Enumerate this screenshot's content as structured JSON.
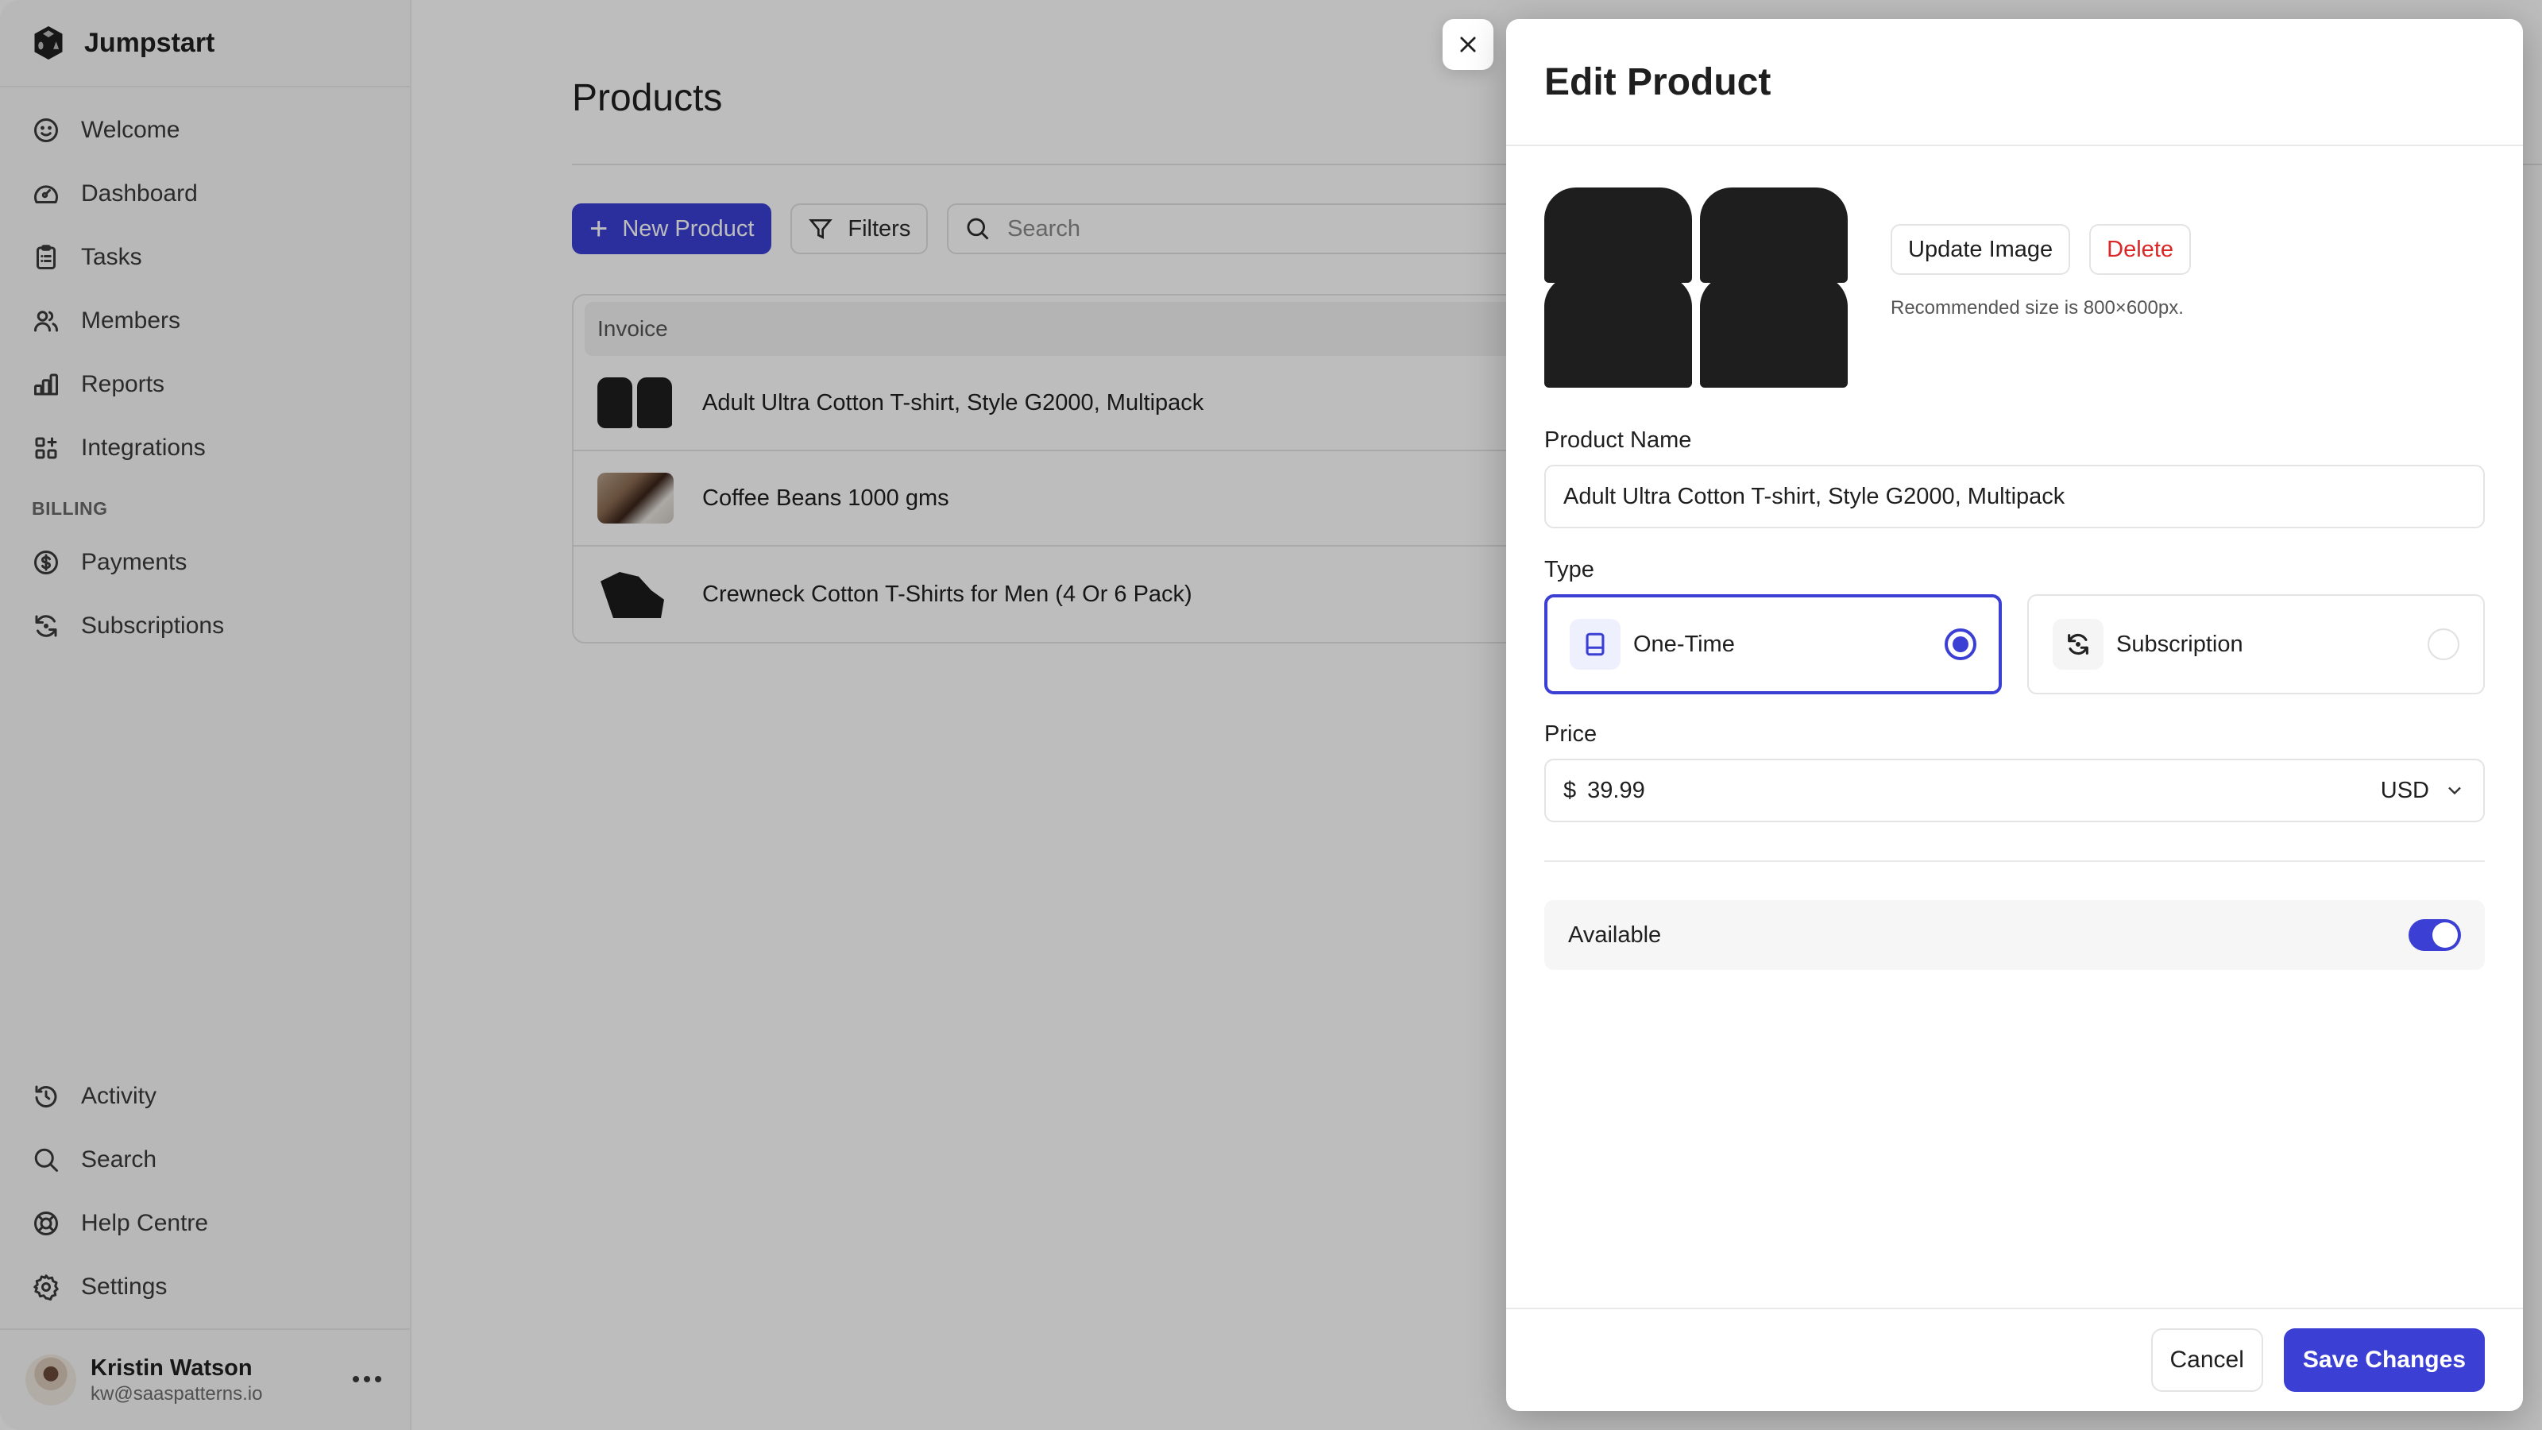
{
  "app": {
    "name": "Jumpstart",
    "accent_color": "#3b3fd4",
    "danger_color": "#d92626"
  },
  "sidebar": {
    "items": [
      {
        "label": "Welcome",
        "icon": "smile-icon"
      },
      {
        "label": "Dashboard",
        "icon": "gauge-icon"
      },
      {
        "label": "Tasks",
        "icon": "clipboard-icon"
      },
      {
        "label": "Members",
        "icon": "users-icon"
      },
      {
        "label": "Reports",
        "icon": "bar-chart-icon"
      },
      {
        "label": "Integrations",
        "icon": "grid-plus-icon"
      }
    ],
    "billing_section": "BILLING",
    "billing_items": [
      {
        "label": "Payments",
        "icon": "dollar-circle-icon"
      },
      {
        "label": "Subscriptions",
        "icon": "refresh-icon"
      }
    ],
    "bottom_items": [
      {
        "label": "Activity",
        "icon": "history-icon"
      },
      {
        "label": "Search",
        "icon": "search-icon"
      },
      {
        "label": "Help Centre",
        "icon": "lifebuoy-icon"
      },
      {
        "label": "Settings",
        "icon": "gear-icon"
      }
    ],
    "user": {
      "name": "Kristin Watson",
      "email": "kw@saaspatterns.io"
    }
  },
  "main": {
    "title": "Products",
    "toolbar": {
      "new_label": "New Product",
      "filters_label": "Filters",
      "search_placeholder": "Search"
    },
    "table": {
      "column_header": "Invoice",
      "rows": [
        {
          "name": "Adult Ultra Cotton T-shirt, Style G2000, Multipack",
          "thumb": "shirts-multipack"
        },
        {
          "name": "Coffee Beans 1000 gms",
          "thumb": "coffee-beans"
        },
        {
          "name": "Crewneck Cotton T-Shirts for Men (4 Or 6 Pack)",
          "thumb": "crewneck-shirts"
        }
      ]
    }
  },
  "panel": {
    "title": "Edit Product",
    "update_image_label": "Update Image",
    "delete_label": "Delete",
    "image_hint": "Recommended size is 800×600px.",
    "product_name_label": "Product Name",
    "product_name_value": "Adult Ultra Cotton T-shirt, Style G2000, Multipack",
    "type_label": "Type",
    "type_options": [
      {
        "label": "One-Time",
        "selected": true
      },
      {
        "label": "Subscription",
        "selected": false
      }
    ],
    "price_label": "Price",
    "currency_symbol": "$",
    "price_value": "39.99",
    "currency": "USD",
    "available_label": "Available",
    "available": true,
    "cancel_label": "Cancel",
    "save_label": "Save Changes"
  }
}
